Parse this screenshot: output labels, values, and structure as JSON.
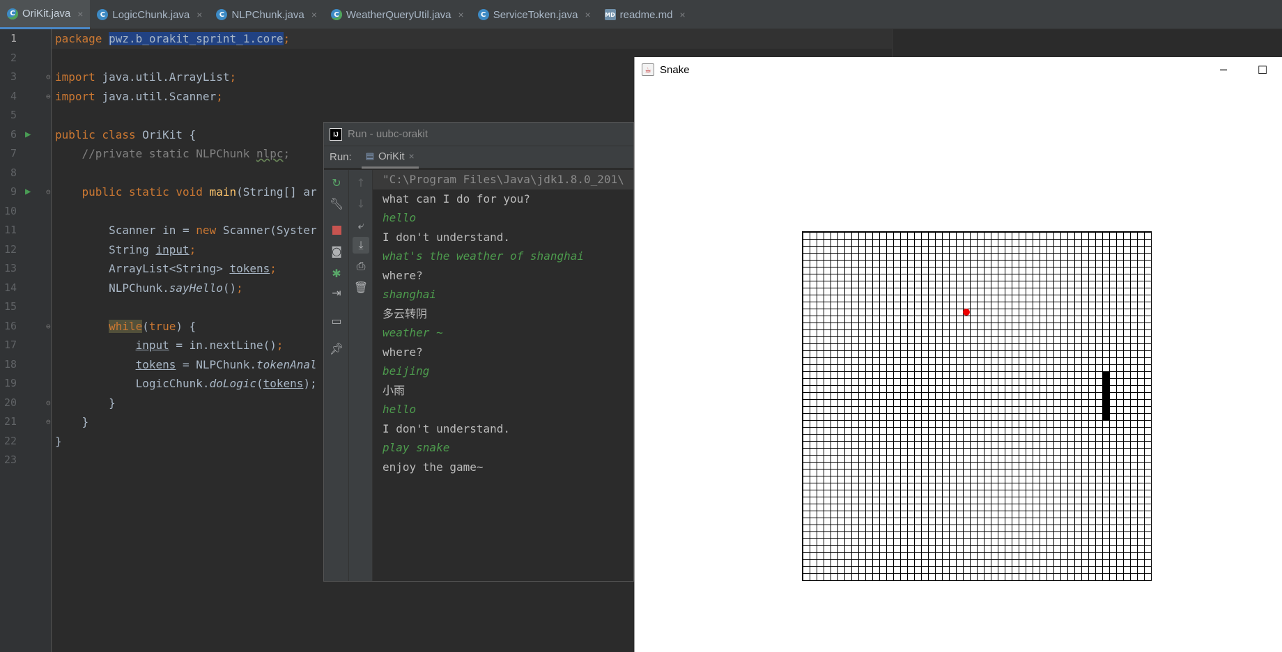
{
  "tabs": [
    {
      "label": "OriKit.java",
      "icon": "java-class-run-icon",
      "active": true
    },
    {
      "label": "LogicChunk.java",
      "icon": "java-class-icon"
    },
    {
      "label": "NLPChunk.java",
      "icon": "java-class-icon"
    },
    {
      "label": "WeatherQueryUtil.java",
      "icon": "java-class-run-icon"
    },
    {
      "label": "ServiceToken.java",
      "icon": "java-class-icon"
    },
    {
      "label": "readme.md",
      "icon": "markdown-icon"
    }
  ],
  "editor": {
    "line_numbers": [
      "1",
      "2",
      "3",
      "4",
      "5",
      "6",
      "7",
      "8",
      "9",
      "10",
      "11",
      "12",
      "13",
      "14",
      "15",
      "16",
      "17",
      "18",
      "19",
      "20",
      "21",
      "22",
      "23"
    ],
    "code": {
      "l1_kw": "package ",
      "l1_pkg": "pwz.b_orakit_sprint_1.core",
      "l1_semi": ";",
      "l3_kw": "import ",
      "l3_rest": "java.util.ArrayList",
      "l3_semi": ";",
      "l4_kw": "import ",
      "l4_rest": "java.util.Scanner",
      "l4_semi": ";",
      "l6_kw": "public class ",
      "l6_rest": "OriKit {",
      "l7_cm": "    //private static NLPChunk ",
      "l7_cm2": "nlpc",
      "l7_cm3": ";",
      "l9_kw": "    public static void ",
      "l9_fn": "main",
      "l9_rest": "(String[] ar",
      "l11_a": "        Scanner in = ",
      "l11_kw": "new ",
      "l11_b": "Scanner(Syster",
      "l12_a": "        String ",
      "l12_v": "input",
      "l12_semi": ";",
      "l13_a": "        ArrayList<String> ",
      "l13_v": "tokens",
      "l13_semi": ";",
      "l14_a": "        NLPChunk.",
      "l14_it": "sayHello",
      "l14_b": "()",
      "l14_semi": ";",
      "l16_pad": "        ",
      "l16_kw": "while",
      "l16_p": "(",
      "l16_kw2": "true",
      "l16_rest": ") {",
      "l17_pad": "            ",
      "l17_v": "input",
      "l17_rest": " = in.nextLine()",
      "l17_semi": ";",
      "l18_pad": "            ",
      "l18_v": "tokens",
      "l18_a": " = NLPChunk.",
      "l18_it": "tokenAnal",
      "l19_a": "            LogicChunk.",
      "l19_it": "doLogic",
      "l19_p": "(",
      "l19_v": "tokens",
      "l19_b": ");",
      "l20": "        }",
      "l21": "    }",
      "l22": "}"
    }
  },
  "run": {
    "title": "Run - uubc-orakit",
    "label": "Run:",
    "tab": "OriKit",
    "console": [
      {
        "text": "\"C:\\Program Files\\Java\\jdk1.8.0_201\\",
        "kind": "cmd"
      },
      {
        "text": "what can I do for you?",
        "kind": "out"
      },
      {
        "text": "hello",
        "kind": "input"
      },
      {
        "text": "I don't understand.",
        "kind": "out"
      },
      {
        "text": "what's the weather of shanghai",
        "kind": "input"
      },
      {
        "text": "where?",
        "kind": "out"
      },
      {
        "text": "shanghai",
        "kind": "input"
      },
      {
        "text": "多云转阴",
        "kind": "out"
      },
      {
        "text": "weather ~",
        "kind": "input"
      },
      {
        "text": "where?",
        "kind": "out"
      },
      {
        "text": "beijing",
        "kind": "input"
      },
      {
        "text": "小雨",
        "kind": "out"
      },
      {
        "text": "hello",
        "kind": "input"
      },
      {
        "text": "I don't understand.",
        "kind": "out"
      },
      {
        "text": "play snake",
        "kind": "input"
      },
      {
        "text": "enjoy the game~",
        "kind": "out"
      }
    ]
  },
  "snake": {
    "title": "Snake",
    "minimize": "─",
    "maximize": "☐",
    "food_color": "#e00000",
    "snake_color": "#000000"
  }
}
